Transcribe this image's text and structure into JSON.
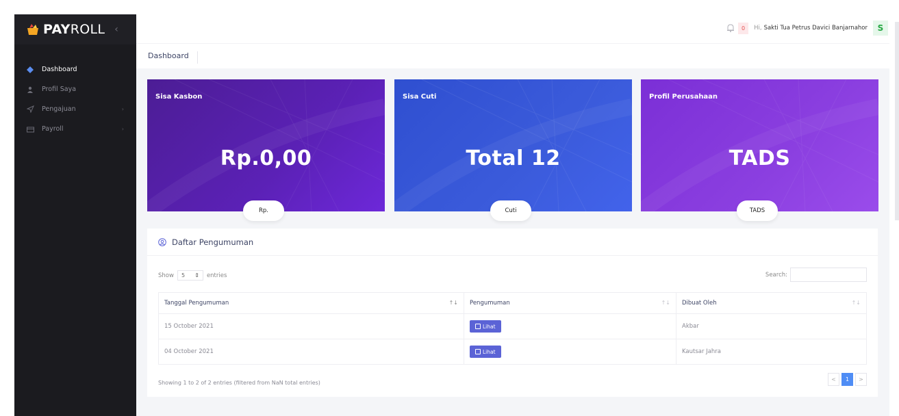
{
  "brand": {
    "bold": "PAY",
    "rest": "ROLL",
    "collapse_icon": "chevron-left-icon"
  },
  "sidebar": {
    "items": [
      {
        "label": "Dashboard",
        "icon": "diamond-icon",
        "active": true
      },
      {
        "label": "Profil Saya",
        "icon": "user-icon"
      },
      {
        "label": "Pengajuan",
        "icon": "send-icon",
        "has_submenu": true
      },
      {
        "label": "Payroll",
        "icon": "wallet-icon",
        "has_submenu": true
      }
    ]
  },
  "topbar": {
    "notif_count": "0",
    "greeting_prefix": "Hi,",
    "user_name": "Sakti Tua Petrus Davici Banjarnahor",
    "avatar_initial": "S"
  },
  "breadcrumb": {
    "current": "Dashboard"
  },
  "cards": [
    {
      "title": "Sisa Kasbon",
      "value": "Rp.0,00",
      "pill": "Rp.",
      "color": "#5b21b6"
    },
    {
      "title": "Sisa Cuti",
      "value": "Total 12",
      "pill": "Cuti",
      "color": "#3b5bdb"
    },
    {
      "title": "Profil Perusahaan",
      "value": "TADS",
      "pill": "TADS",
      "color": "#8b3fe0"
    }
  ],
  "announcements": {
    "title": "Daftar Pengumuman",
    "show_label": "Show",
    "entries_value": "5",
    "entries_label": "entries",
    "search_label": "Search:",
    "columns": [
      "Tanggal Pengumuman",
      "Pengumuman",
      "Dibuat Oleh"
    ],
    "rows": [
      {
        "date": "15 October 2021",
        "action": "Lihat",
        "author": "Akbar"
      },
      {
        "date": "04 October 2021",
        "action": "Lihat",
        "author": "Kautsar Jahra"
      }
    ],
    "footer_info": "Showing 1 to 2 of 2 entries (filtered from NaN total entries)",
    "pagination": {
      "prev": "<",
      "current": "1",
      "next": ">"
    }
  }
}
